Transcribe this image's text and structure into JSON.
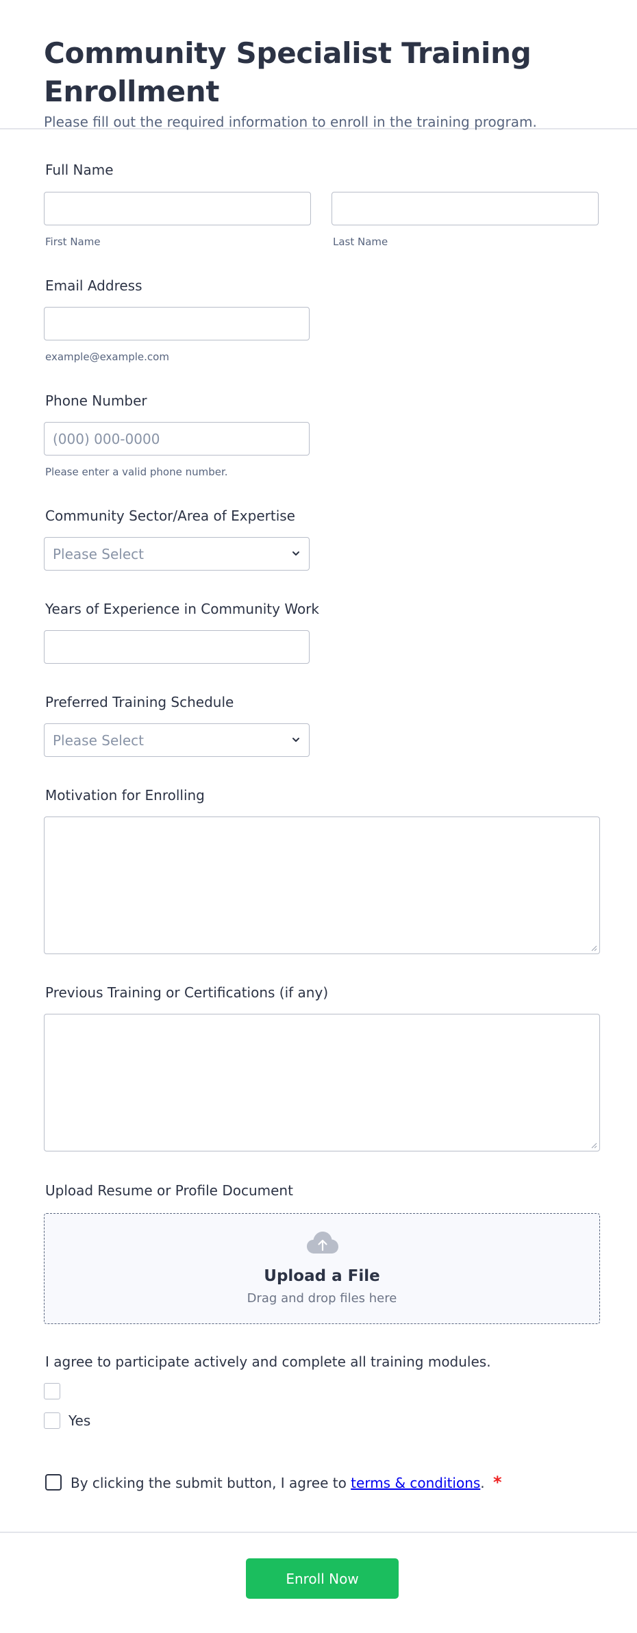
{
  "header": {
    "title": "Community Specialist Training Enrollment",
    "subtitle": "Please fill out the required information to enroll in the training program."
  },
  "full_name": {
    "label": "Full Name",
    "first_sublabel": "First Name",
    "last_sublabel": "Last Name",
    "first_value": "",
    "last_value": ""
  },
  "email": {
    "label": "Email Address",
    "value": "",
    "sublabel": "example@example.com"
  },
  "phone": {
    "label": "Phone Number",
    "placeholder": "(000) 000-0000",
    "sublabel": "Please enter a valid phone number."
  },
  "sector": {
    "label": "Community Sector/Area of Expertise",
    "selected": "Please Select"
  },
  "experience": {
    "label": "Years of Experience in Community Work",
    "value": ""
  },
  "schedule": {
    "label": "Preferred Training Schedule",
    "selected": "Please Select"
  },
  "motivation": {
    "label": "Motivation for Enrolling",
    "value": ""
  },
  "previous": {
    "label": "Previous Training or Certifications (if any)",
    "value": ""
  },
  "upload": {
    "label": "Upload Resume or Profile Document",
    "title": "Upload a File",
    "subtitle": "Drag and drop files here",
    "icon": "cloud-upload-icon"
  },
  "agreement": {
    "label": "I agree to participate actively and complete all training modules.",
    "options": [
      "",
      "Yes"
    ]
  },
  "terms": {
    "prefix": "By clicking the submit button, I agree to ",
    "link_text": "terms & conditions",
    "suffix": ".",
    "required_mark": "*"
  },
  "submit": {
    "label": "Enroll Now"
  },
  "colors": {
    "submit_bg": "#1bbe5e",
    "required": "#ef2121",
    "link": "#0000ee"
  }
}
